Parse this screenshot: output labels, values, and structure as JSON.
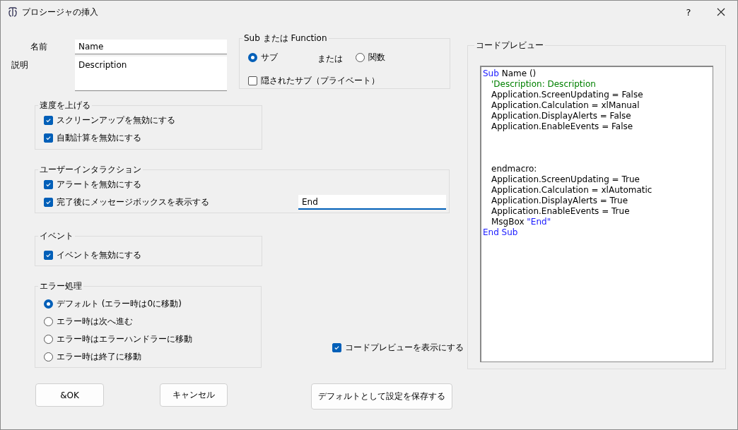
{
  "window": {
    "title": "プロシージャの挿入",
    "help": "?"
  },
  "fields": {
    "name": {
      "label": "名前",
      "value": "Name"
    },
    "description": {
      "label": "説明",
      "value": "Description"
    }
  },
  "sub_or_function": {
    "title": "Sub または Function",
    "separator": "または",
    "options": [
      {
        "label": "サブ",
        "selected": true
      },
      {
        "label": "関数",
        "selected": false
      }
    ],
    "private": {
      "label": "隠されたサブ（プライベート）",
      "checked": false
    }
  },
  "speed_up": {
    "title": "速度を上げる",
    "options": [
      {
        "label": "スクリーンアップを無効にする",
        "checked": true
      },
      {
        "label": "自動計算を無効にする",
        "checked": true
      }
    ]
  },
  "user_interaction": {
    "title": "ユーザーインタラクション",
    "options": [
      {
        "label": "アラートを無効にする",
        "checked": true
      },
      {
        "label": "完了後にメッセージボックスを表示する",
        "checked": true
      }
    ],
    "message_value": "End"
  },
  "events": {
    "title": "イベント",
    "options": [
      {
        "label": "イベントを無効にする",
        "checked": true
      }
    ]
  },
  "error_handling": {
    "title": "エラー処理",
    "options": [
      {
        "label": "デフォルト (エラー時は0に移動)",
        "selected": true
      },
      {
        "label": "エラー時は次へ進む",
        "selected": false
      },
      {
        "label": "エラー時はエラーハンドラーに移動",
        "selected": false
      },
      {
        "label": "エラー時は終了に移動",
        "selected": false
      }
    ]
  },
  "show_preview": {
    "label": "コードプレビューを表示にする",
    "checked": true
  },
  "buttons": {
    "ok": "&OK",
    "cancel": "キャンセル",
    "save_defaults": "デフォルトとして設定を保存する"
  },
  "code_preview": {
    "title": "コードプレビュー",
    "lines": [
      {
        "kind": "code",
        "indent": false,
        "tokens": [
          {
            "kind": "keyword",
            "text": "Sub"
          },
          {
            "kind": "plain",
            "text": " Name ()"
          }
        ]
      },
      {
        "kind": "code",
        "indent": true,
        "tokens": [
          {
            "kind": "comment",
            "text": "'Description: Description"
          }
        ]
      },
      {
        "kind": "code",
        "indent": true,
        "tokens": [
          {
            "kind": "plain",
            "text": "Application.ScreenUpdating = False"
          }
        ]
      },
      {
        "kind": "code",
        "indent": true,
        "tokens": [
          {
            "kind": "plain",
            "text": "Application.Calculation = xlManual"
          }
        ]
      },
      {
        "kind": "code",
        "indent": true,
        "tokens": [
          {
            "kind": "plain",
            "text": "Application.DisplayAlerts = False"
          }
        ]
      },
      {
        "kind": "code",
        "indent": true,
        "tokens": [
          {
            "kind": "plain",
            "text": "Application.EnableEvents = False"
          }
        ]
      },
      {
        "kind": "blank"
      },
      {
        "kind": "blank"
      },
      {
        "kind": "blank"
      },
      {
        "kind": "code",
        "indent": true,
        "tokens": [
          {
            "kind": "plain",
            "text": "endmacro:"
          }
        ]
      },
      {
        "kind": "code",
        "indent": true,
        "tokens": [
          {
            "kind": "plain",
            "text": "Application.ScreenUpdating = True"
          }
        ]
      },
      {
        "kind": "code",
        "indent": true,
        "tokens": [
          {
            "kind": "plain",
            "text": "Application.Calculation = xlAutomatic"
          }
        ]
      },
      {
        "kind": "code",
        "indent": true,
        "tokens": [
          {
            "kind": "plain",
            "text": "Application.DisplayAlerts = True"
          }
        ]
      },
      {
        "kind": "code",
        "indent": true,
        "tokens": [
          {
            "kind": "plain",
            "text": "Application.EnableEvents = True"
          }
        ]
      },
      {
        "kind": "code",
        "indent": true,
        "tokens": [
          {
            "kind": "plain",
            "text": "MsgBox "
          },
          {
            "kind": "string",
            "text": "\"End\""
          }
        ]
      },
      {
        "kind": "code",
        "indent": false,
        "tokens": [
          {
            "kind": "keyword",
            "text": "End Sub"
          }
        ]
      }
    ]
  }
}
